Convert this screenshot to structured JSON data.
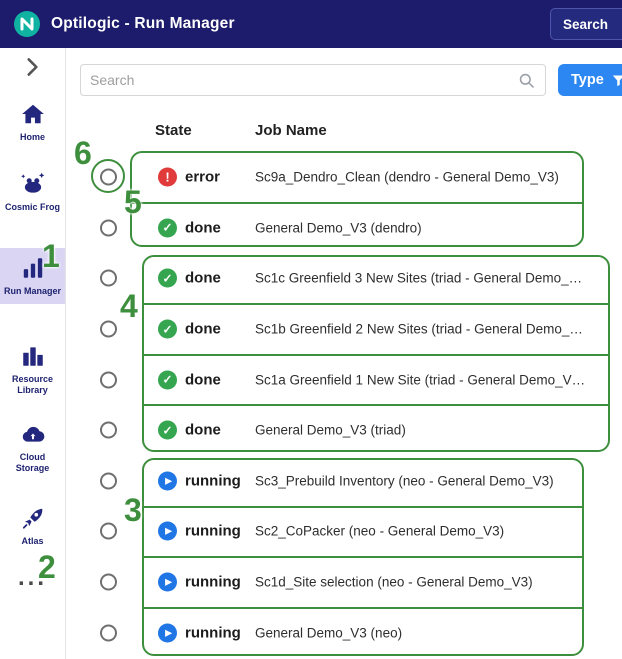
{
  "header": {
    "app_title": "Optilogic - Run Manager",
    "search_button_label": "Search"
  },
  "sidebar": {
    "items": [
      {
        "label": "Home",
        "active": false
      },
      {
        "label": "Cosmic Frog",
        "active": false
      },
      {
        "label": "Run Manager",
        "active": true
      },
      {
        "label": "Resource Library",
        "active": false
      },
      {
        "label": "Cloud Storage",
        "active": false
      },
      {
        "label": "Atlas",
        "active": false
      }
    ],
    "overflow_label": "..."
  },
  "toolbar": {
    "search_placeholder": "Search",
    "type_button_label": "Type"
  },
  "table": {
    "columns": {
      "state": "State",
      "job_name": "Job Name"
    },
    "rows": [
      {
        "state": "error",
        "job_name": "Sc9a_Dendro_Clean (dendro - General Demo_V3)"
      },
      {
        "state": "done",
        "job_name": "General Demo_V3 (dendro)"
      },
      {
        "state": "done",
        "job_name": "Sc1c Greenfield 3 New Sites (triad - General Demo_…"
      },
      {
        "state": "done",
        "job_name": "Sc1b Greenfield 2 New Sites (triad - General Demo_…"
      },
      {
        "state": "done",
        "job_name": "Sc1a Greenfield 1 New Site (triad - General Demo_V…"
      },
      {
        "state": "done",
        "job_name": "General Demo_V3 (triad)"
      },
      {
        "state": "running",
        "job_name": "Sc3_Prebuild Inventory (neo - General Demo_V3)"
      },
      {
        "state": "running",
        "job_name": "Sc2_CoPacker (neo - General Demo_V3)"
      },
      {
        "state": "running",
        "job_name": "Sc1d_Site selection (neo - General Demo_V3)"
      },
      {
        "state": "running",
        "job_name": "General Demo_V3 (neo)"
      }
    ]
  },
  "annotations": {
    "labels": [
      "1",
      "2",
      "3",
      "4",
      "5",
      "6"
    ]
  },
  "colors": {
    "topbar": "#1d1b6b",
    "accent_blue": "#2d87f2",
    "error": "#e03a3a",
    "done": "#35a550",
    "running": "#2176e5",
    "annotation_green": "#3e8f3d",
    "logo_teal": "#10b2a2"
  }
}
